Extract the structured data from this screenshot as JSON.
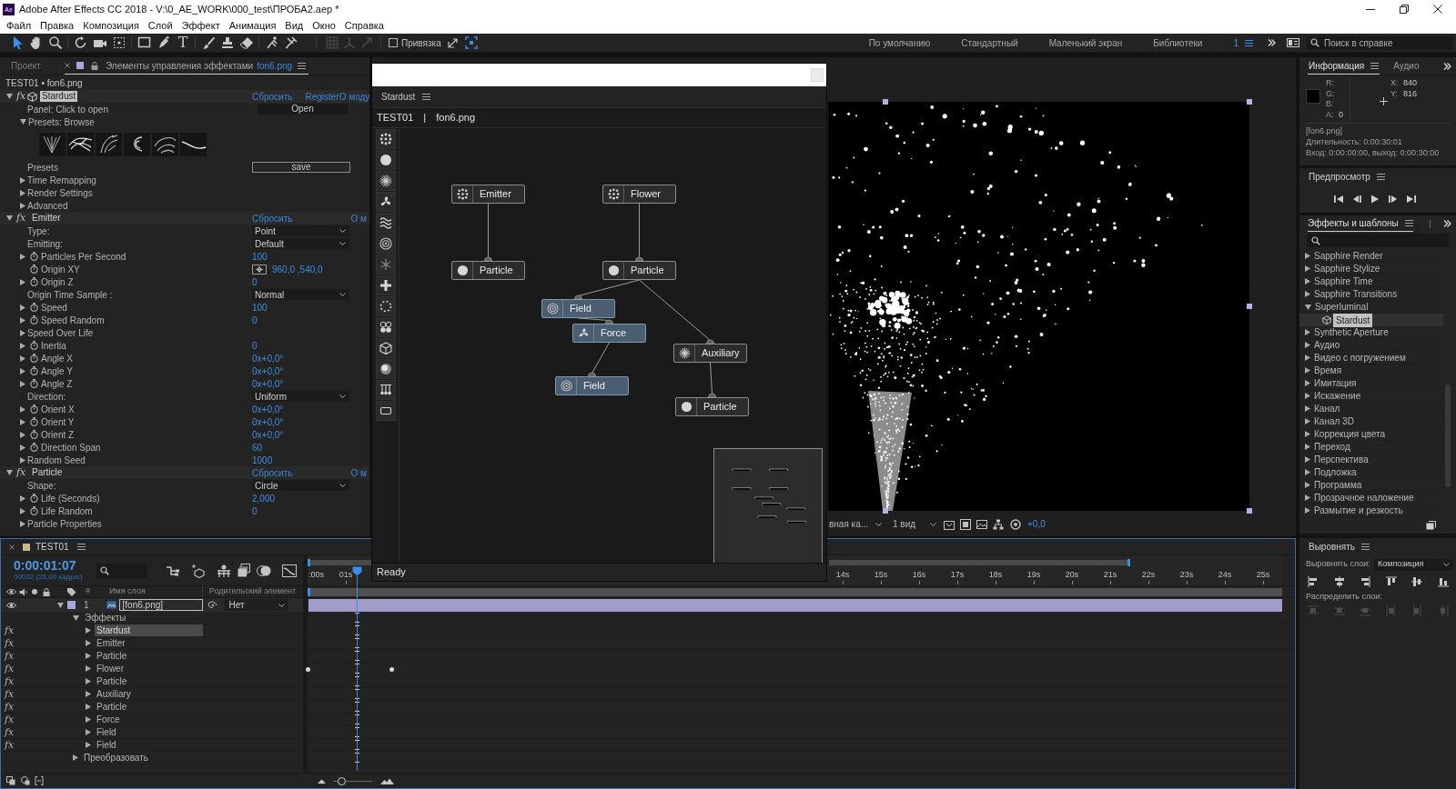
{
  "window": {
    "app_icon": "Ae",
    "title": "Adobe After Effects CC 2018 - V:\\0_AE_WORK\\000_test\\ПРОБА2.aep *"
  },
  "menu": [
    "Файл",
    "Правка",
    "Композиция",
    "Слой",
    "Эффект",
    "Анимация",
    "Вид",
    "Окно",
    "Справка"
  ],
  "toolbar": {
    "tools": [
      {
        "kind": "selection",
        "selected": true
      },
      {
        "kind": "hand",
        "selected": false
      },
      {
        "kind": "zoom",
        "selected": false
      },
      {
        "kind": "rotate",
        "selected": false
      },
      {
        "kind": "camera",
        "selected": false
      },
      {
        "kind": "pan",
        "selected": false
      },
      {
        "kind": "rectangle",
        "selected": false
      },
      {
        "kind": "pen",
        "selected": false
      },
      {
        "kind": "type",
        "label": "T",
        "selected": false
      },
      {
        "kind": "brush",
        "selected": false
      },
      {
        "kind": "clone",
        "selected": false
      },
      {
        "kind": "eraser",
        "selected": false
      },
      {
        "kind": "roto",
        "selected": false
      },
      {
        "kind": "puppet",
        "selected": false
      }
    ],
    "axis_modes": {
      "disabled": true
    },
    "snap": {
      "label": "Привязка",
      "checked": false
    },
    "workspaces": [
      {
        "label": "По умолчанию",
        "selected": false
      },
      {
        "label": "Стандартный",
        "selected": false
      },
      {
        "label": "Маленький экран",
        "selected": false
      },
      {
        "label": "Библиотеки",
        "selected": false
      }
    ],
    "workspace_number": "1",
    "help_search": {
      "placeholder": "Поиск в справке"
    }
  },
  "effect_controls": {
    "tabs": [
      {
        "label": "Проект",
        "selected": false
      },
      {
        "label": "Элементы управления эффектами",
        "file": "fon6.png",
        "selected": true
      }
    ],
    "breadcrumb": "TEST01 • fon6.png",
    "rows": [
      {
        "kind": "effect",
        "fx": "fx",
        "on": true,
        "label": "Stardust",
        "plugin": true,
        "expanded": true,
        "selected": true,
        "links": [
          "Сбросить",
          "Register",
          "О моду"
        ]
      },
      {
        "kind": "button",
        "label": "Panel: Click to open",
        "button": "Open",
        "outlined": false
      },
      {
        "kind": "group",
        "label": "Presets: Browse",
        "expanded": true
      },
      {
        "kind": "thumbnails"
      },
      {
        "kind": "button",
        "label": "Presets",
        "button": "save",
        "outlined": true
      },
      {
        "kind": "group",
        "label": "Time Remapping",
        "expanded": false
      },
      {
        "kind": "group",
        "label": "Render Settings",
        "expanded": false
      },
      {
        "kind": "group",
        "label": "Advanced",
        "expanded": false
      },
      {
        "kind": "effect",
        "fx": "fx",
        "on": true,
        "label": "Emitter",
        "expanded": true,
        "selected": false,
        "links": [
          "Сбросить",
          "О м"
        ]
      },
      {
        "kind": "dropdown",
        "label": "Type:",
        "value": "Point"
      },
      {
        "kind": "dropdown",
        "label": "Emitting:",
        "value": "Default"
      },
      {
        "kind": "property",
        "label": "Particles Per Second",
        "expanded": false,
        "value": "100"
      },
      {
        "kind": "point",
        "label": "Origin XY",
        "value": "960,0 ,540,0"
      },
      {
        "kind": "property",
        "label": "Origin Z",
        "expanded": false,
        "value": "0"
      },
      {
        "kind": "dropdown",
        "label": "Origin Time Sample :",
        "value": "Normal"
      },
      {
        "kind": "property",
        "label": "Speed",
        "expanded": false,
        "value": "100"
      },
      {
        "kind": "property",
        "label": "Speed Random",
        "expanded": false,
        "value": "0"
      },
      {
        "kind": "group",
        "label": "Speed Over Life",
        "expanded": false
      },
      {
        "kind": "property",
        "label": "Inertia",
        "expanded": false,
        "value": "0"
      },
      {
        "kind": "property",
        "label": "Angle X",
        "expanded": false,
        "value": "0x+0,0°"
      },
      {
        "kind": "property",
        "label": "Angle Y",
        "expanded": false,
        "value": "0x+0,0°"
      },
      {
        "kind": "property",
        "label": "Angle Z",
        "expanded": false,
        "value": "0x+0,0°"
      },
      {
        "kind": "dropdown",
        "label": "Direction:",
        "value": "Uniform"
      },
      {
        "kind": "property",
        "label": "Orient X",
        "expanded": false,
        "value": "0x+0,0°"
      },
      {
        "kind": "property",
        "label": "Orient Y",
        "expanded": false,
        "value": "0x+0,0°"
      },
      {
        "kind": "property",
        "label": "Orient Z",
        "expanded": false,
        "value": "0x+0,0°"
      },
      {
        "kind": "property",
        "label": "Direction Span",
        "expanded": false,
        "value": "60"
      },
      {
        "kind": "group",
        "label": "Random Seed",
        "expanded": false,
        "value": "1000"
      },
      {
        "kind": "effect",
        "fx": "fx",
        "on": true,
        "label": "Particle",
        "expanded": true,
        "selected": false,
        "links": [
          "Сбросить",
          "О м"
        ]
      },
      {
        "kind": "dropdown",
        "label": "Shape:",
        "value": "Circle"
      },
      {
        "kind": "property",
        "label": "Life (Seconds)",
        "expanded": false,
        "value": "2,000"
      },
      {
        "kind": "property",
        "label": "Life Random",
        "expanded": false,
        "value": "0"
      },
      {
        "kind": "group",
        "label": "Particle Properties",
        "expanded": false
      }
    ]
  },
  "stardust": {
    "title": "Stardust",
    "comp": "TEST01",
    "separator": "|",
    "layer": "fon6.png",
    "nodes": [
      {
        "label": "Emitter",
        "kind": "emitter",
        "selected": false,
        "children": [
          {
            "label": "Particle",
            "kind": "particle",
            "selected": false
          }
        ]
      },
      {
        "label": "Flower",
        "kind": "emitter",
        "selected": false,
        "children": [
          {
            "label": "Particle",
            "kind": "particle",
            "selected": false,
            "children": [
              {
                "label": "Field",
                "kind": "field",
                "selected": true,
                "children": [
                  {
                    "label": "Force",
                    "kind": "force",
                    "selected": true,
                    "children": [
                      {
                        "label": "Field",
                        "kind": "field",
                        "selected": true
                      }
                    ]
                  }
                ]
              },
              {
                "label": "Auxiliary",
                "kind": "auxiliary",
                "selected": false,
                "children": [
                  {
                    "label": "Particle",
                    "kind": "particle",
                    "selected": false
                  }
                ]
              }
            ]
          }
        ]
      }
    ],
    "status": "Ready"
  },
  "composition": {
    "camera": "вная ка...",
    "view": "1 вид",
    "exposure": "+0,0"
  },
  "info": {
    "tabs": [
      {
        "label": "Информация",
        "selected": true
      },
      {
        "label": "Аудио",
        "selected": false
      }
    ],
    "channels": [
      {
        "label": "R:"
      },
      {
        "label": "G:"
      },
      {
        "label": "B:"
      },
      {
        "label": "A:",
        "value": "0"
      }
    ],
    "coords": [
      {
        "label": "X:",
        "value": "840"
      },
      {
        "label": "Y:",
        "value": "816"
      }
    ],
    "lines": [
      "[fon6.png]",
      "Длительность: 0:00:30:01",
      "Вход: 0:00:00:00, выход: 0:00:30:00"
    ]
  },
  "preview": {
    "title": "Предпросмотр"
  },
  "effects_presets": {
    "title": "Эффекты и шаблоны",
    "items": [
      {
        "label": "Sapphire Render",
        "expanded": false,
        "selected": false
      },
      {
        "label": "Sapphire Stylize",
        "expanded": false,
        "selected": false
      },
      {
        "label": "Sapphire Time",
        "expanded": false,
        "selected": false
      },
      {
        "label": "Sapphire Transitions",
        "expanded": false,
        "selected": false
      },
      {
        "label": "Superluminal",
        "expanded": true,
        "selected": false,
        "children": [
          {
            "label": "Stardust",
            "selected": true
          }
        ]
      },
      {
        "label": "Synthetic Aperture",
        "expanded": false,
        "selected": false
      },
      {
        "label": "Аудио",
        "expanded": false,
        "selected": false
      },
      {
        "label": "Видео с погружением",
        "expanded": false,
        "selected": false
      },
      {
        "label": "Время",
        "expanded": false,
        "selected": false
      },
      {
        "label": "Имитация",
        "expanded": false,
        "selected": false
      },
      {
        "label": "Искажение",
        "expanded": false,
        "selected": false
      },
      {
        "label": "Канал",
        "expanded": false,
        "selected": false
      },
      {
        "label": "Канал 3D",
        "expanded": false,
        "selected": false
      },
      {
        "label": "Коррекция цвета",
        "expanded": false,
        "selected": false
      },
      {
        "label": "Переход",
        "expanded": false,
        "selected": false
      },
      {
        "label": "Перспектива",
        "expanded": false,
        "selected": false
      },
      {
        "label": "Подложка",
        "expanded": false,
        "selected": false
      },
      {
        "label": "Программа",
        "expanded": false,
        "selected": false
      },
      {
        "label": "Прозрачное наложение",
        "expanded": false,
        "selected": false
      },
      {
        "label": "Размытие и резкость",
        "expanded": false,
        "selected": false
      }
    ]
  },
  "align": {
    "title": "Выровнять",
    "align_label": "Выровнять слои:",
    "align_to": "Композиция",
    "distribute_label": "Распределить слои:",
    "distribute_disabled": true
  },
  "timeline": {
    "focused": true,
    "tab": "TEST01",
    "timecode": "0:00:01:07",
    "frame_info": "00032 (25,00 кадр/с)",
    "columns": {
      "number": "#",
      "name": "Имя слоя",
      "parent": "Родительский элемент"
    },
    "ruler": [
      ":00s",
      "01s",
      "14s",
      "15s",
      "16s",
      "17s",
      "18s",
      "19s",
      "20s",
      "21s",
      "22s",
      "23s",
      "24s",
      "25s"
    ],
    "playhead": {
      "level": 0.051
    },
    "layers": [
      {
        "visible": true,
        "expanded": true,
        "number": "1",
        "name": "[fon6.png]",
        "selected": true,
        "parent": "Нет",
        "children": [
          {
            "label": "Эффекты",
            "expanded": true,
            "selected": false,
            "children": [
              {
                "fx": "fx",
                "label": "Stardust",
                "expanded": false,
                "selected": true
              },
              {
                "fx": "fx",
                "label": "Emitter",
                "expanded": false,
                "selected": false
              },
              {
                "fx": "fx",
                "label": "Particle",
                "expanded": false,
                "selected": false
              },
              {
                "fx": "fx",
                "label": "Flower",
                "expanded": false,
                "selected": false,
                "keyframes": true
              },
              {
                "fx": "fx",
                "label": "Particle",
                "expanded": false,
                "selected": false
              },
              {
                "fx": "fx",
                "label": "Auxiliary",
                "expanded": false,
                "selected": false
              },
              {
                "fx": "fx",
                "label": "Particle",
                "expanded": false,
                "selected": false
              },
              {
                "fx": "fx",
                "label": "Force",
                "expanded": false,
                "selected": false
              },
              {
                "fx": "fx",
                "label": "Field",
                "expanded": false,
                "selected": false
              },
              {
                "fx": "fx",
                "label": "Field",
                "expanded": false,
                "selected": false
              }
            ]
          },
          {
            "label": "Преобразовать",
            "expanded": false,
            "selected": false
          }
        ]
      }
    ],
    "zoom": {
      "level": 0.15
    }
  }
}
